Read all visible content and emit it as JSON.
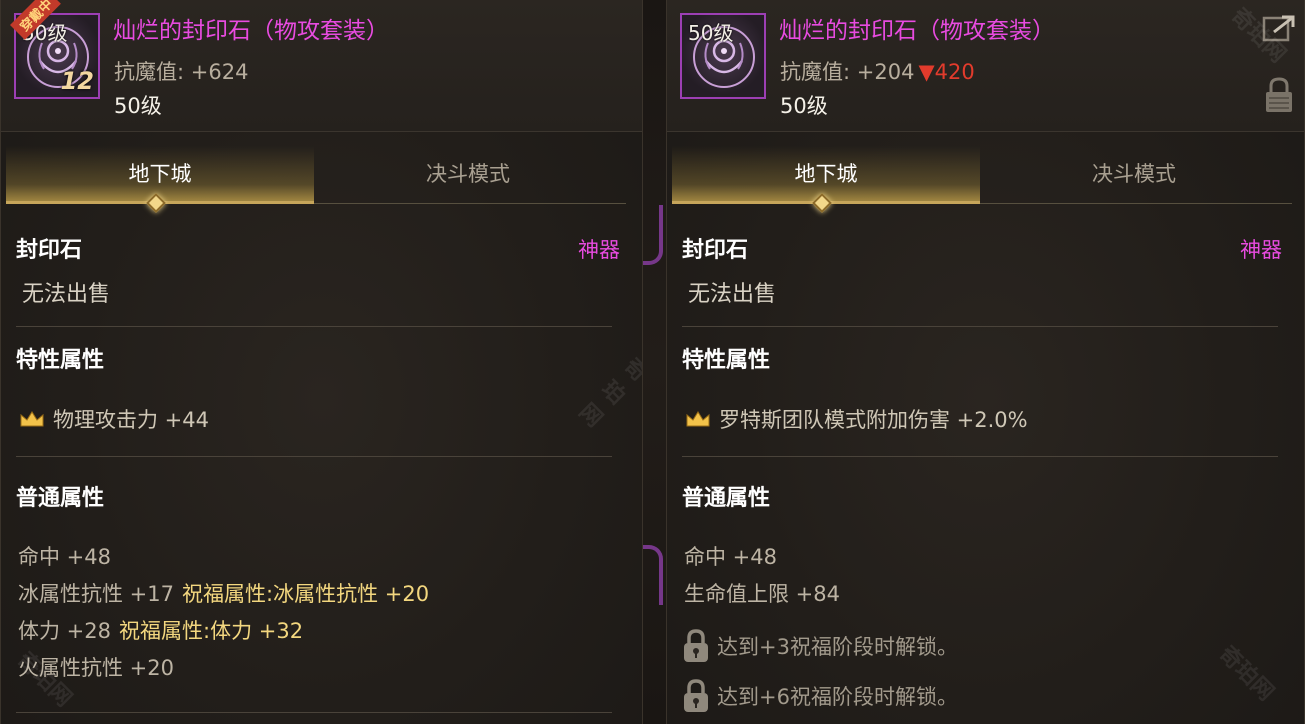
{
  "left": {
    "icon": {
      "level": "50级",
      "ribbon": "穿戴中",
      "enhance": "12"
    },
    "name": "灿烂的封印石（物攻套装）",
    "stat_label": "抗魔值:",
    "stat_value": "+624",
    "level": "50级",
    "tabs": [
      {
        "label": "地下城"
      },
      {
        "label": "决斗模式"
      }
    ],
    "category": "封印石",
    "rarity": "神器",
    "note": "无法出售",
    "trait_title": "特性属性",
    "trait": "物理攻击力 +44",
    "common_title": "普通属性",
    "attrs": [
      {
        "text": "命中 +48",
        "bless": ""
      },
      {
        "text": "冰属性抗性 +17",
        "bless": "祝福属性:冰属性抗性 +20"
      },
      {
        "text": "体力 +28",
        "bless": "祝福属性:体力 +32"
      },
      {
        "text": "火属性抗性 +20",
        "bless": ""
      }
    ]
  },
  "right": {
    "icon": {
      "level": "50级"
    },
    "name": "灿烂的封印石（物攻套装）",
    "stat_label": "抗魔值:",
    "stat_value": "+204",
    "stat_delta": "▼420",
    "level": "50级",
    "tabs": [
      {
        "label": "地下城"
      },
      {
        "label": "决斗模式"
      }
    ],
    "category": "封印石",
    "rarity": "神器",
    "note": "无法出售",
    "trait_title": "特性属性",
    "trait": "罗特斯团队模式附加伤害 +2.0%",
    "common_title": "普通属性",
    "attrs": [
      {
        "text": "命中 +48"
      },
      {
        "text": "生命值上限 +84"
      }
    ],
    "locked": [
      {
        "text": "达到+3祝福阶段时解锁。"
      },
      {
        "text": "达到+6祝福阶段时解锁。"
      }
    ]
  },
  "watermark": "奇珀网",
  "colors": {
    "name": "#e84be0",
    "bless": "#f3d77f",
    "down": "#e23b2c",
    "tab_gold": "#c6a55a"
  }
}
